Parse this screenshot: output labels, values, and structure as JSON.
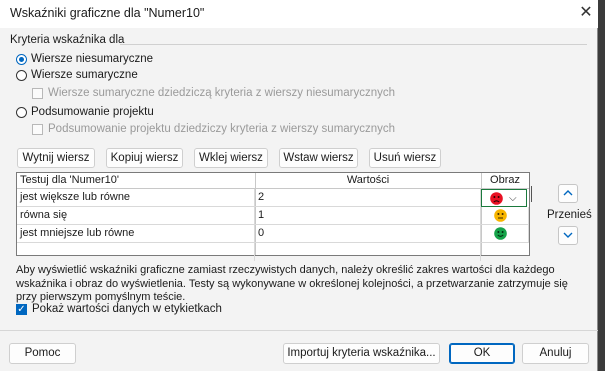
{
  "window": {
    "title": "Wskaźniki graficzne dla \"Numer10\"",
    "close_glyph": "✕"
  },
  "criteria": {
    "group_label": "Kryteria wskaźnika dla",
    "options": [
      {
        "label": "Wiersze niesumaryczne",
        "selected": true
      },
      {
        "label": "Wiersze sumaryczne",
        "selected": false
      },
      {
        "label": "Podsumowanie projektu",
        "selected": false
      }
    ],
    "inherit_summary_label": "Wiersze sumaryczne dziedziczą kryteria z wierszy niesumarycznych",
    "inherit_project_label": "Podsumowanie projektu dziedziczy kryteria z wierszy sumarycznych"
  },
  "toolbar": {
    "cut": "Wytnij wiersz",
    "copy": "Kopiuj wiersz",
    "paste": "Wklej wiersz",
    "insert": "Wstaw wiersz",
    "delete": "Usuń wiersz"
  },
  "grid": {
    "headers": {
      "test": "Testuj dla 'Numer10'",
      "values": "Wartości",
      "image": "Obraz"
    },
    "rows": [
      {
        "test": "jest większe lub równe",
        "value": "2",
        "image": "red-sad-face-icon"
      },
      {
        "test": "równa się",
        "value": "1",
        "image": "yellow-neutral-face-icon"
      },
      {
        "test": "jest mniejsze lub równe",
        "value": "0",
        "image": "green-happy-face-icon"
      }
    ],
    "move_label": "Przenieś"
  },
  "info_text": "Aby wyświetlić wskaźniki graficzne zamiast rzeczywistych danych, należy określić zakres wartości dla każdego wskaźnika i obraz do wyświetlenia. Testy są wykonywane w określonej kolejności, a przetwarzanie zatrzymuje się przy pierwszym pomyślnym teście.",
  "show_values": {
    "label": "Pokaż wartości danych w etykietkach",
    "checked": true
  },
  "footer": {
    "help": "Pomoc",
    "import": "Importuj kryteria wskaźnika...",
    "ok": "OK",
    "cancel": "Anuluj"
  },
  "colors": {
    "accent": "#0067c0",
    "red_face": "#e81123",
    "yellow_face": "#f7b500",
    "green_face": "#16a34a"
  }
}
